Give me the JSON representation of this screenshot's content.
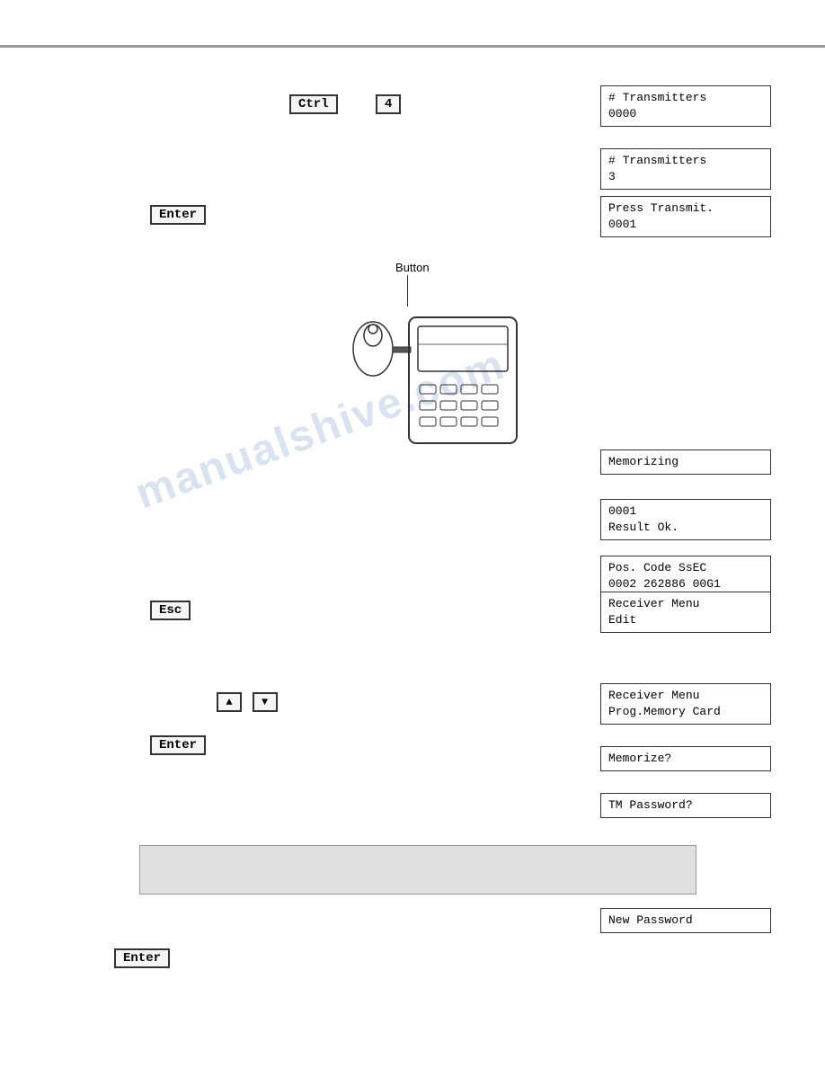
{
  "page": {
    "top_border": true
  },
  "keys": {
    "ctrl": "Ctrl",
    "four": "4",
    "enter": "Enter",
    "esc": "Esc",
    "enter2": "Enter",
    "enter3": "Enter",
    "arrow_up": "▲",
    "arrow_down": "▼"
  },
  "lcd_boxes": {
    "box1": {
      "line1": "# Transmitters",
      "line2": "0000"
    },
    "box2": {
      "line1": "# Transmitters",
      "line2": "3"
    },
    "box3": {
      "line1": "Press Transmit.",
      "line2": "0001"
    },
    "box4": {
      "line1": "Memorizing"
    },
    "box5": {
      "line1": "     0001",
      "line2": "Result Ok."
    },
    "box6": {
      "line1": "Pos. Code  SsEC",
      "line2": "0002 262886 00G1"
    },
    "box7": {
      "line1": "Receiver Menu",
      "line2": "Edit"
    },
    "box8": {
      "line1": "Receiver Menu",
      "line2": "Prog.Memory Card"
    },
    "box9": {
      "line1": "Memorize?"
    },
    "box10": {
      "line1": "TM Password?"
    },
    "box11": {
      "line1": "New Password"
    }
  },
  "button_label": "Button",
  "watermark": "manualshive.com"
}
